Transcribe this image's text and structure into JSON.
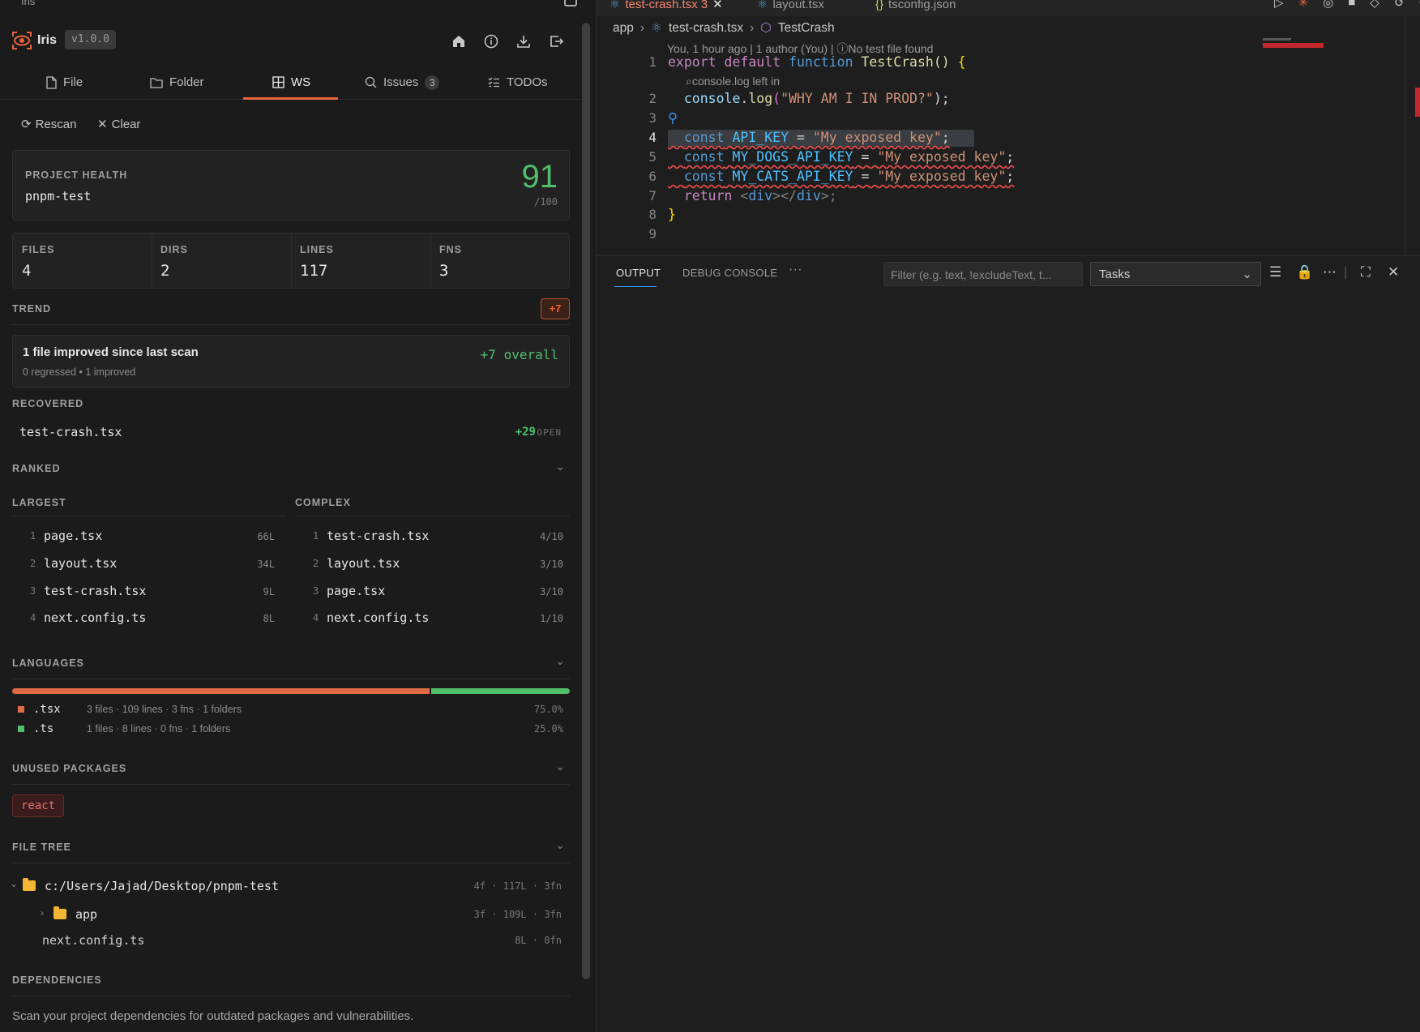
{
  "window": {
    "title": "Iris"
  },
  "app": {
    "name": "Iris",
    "version": "v1.0.0"
  },
  "tabs": [
    {
      "label": "File",
      "icon": "file-icon"
    },
    {
      "label": "Folder",
      "icon": "folder-icon"
    },
    {
      "label": "WS",
      "icon": "grid-icon",
      "active": true
    },
    {
      "label": "Issues",
      "icon": "search-icon",
      "badge": "3"
    },
    {
      "label": "TODOs",
      "icon": "checklist-icon"
    }
  ],
  "actions": {
    "rescan": "Rescan",
    "clear": "Clear"
  },
  "health": {
    "label": "PROJECT HEALTH",
    "project": "pnpm-test",
    "score": "91",
    "max": "/100",
    "score_color": "#4fbf6a"
  },
  "stats": [
    {
      "label": "FILES",
      "value": "4"
    },
    {
      "label": "DIRS",
      "value": "2"
    },
    {
      "label": "LINES",
      "value": "117"
    },
    {
      "label": "FNS",
      "value": "3"
    }
  ],
  "trend": {
    "label": "TREND",
    "badge": "+7",
    "headline": "1 file improved since last scan",
    "detail": "0 regressed • 1 improved",
    "overall": "+7 overall"
  },
  "recovered": {
    "label": "RECOVERED",
    "file": "test-crash.tsx",
    "delta": "+29",
    "action": "OPEN"
  },
  "ranked": {
    "label": "RANKED",
    "largest_label": "LARGEST",
    "complex_label": "COMPLEX",
    "largest": [
      {
        "n": "1",
        "file": "page.tsx",
        "metric": "66L"
      },
      {
        "n": "2",
        "file": "layout.tsx",
        "metric": "34L"
      },
      {
        "n": "3",
        "file": "test-crash.tsx",
        "metric": "9L"
      },
      {
        "n": "4",
        "file": "next.config.ts",
        "metric": "8L"
      }
    ],
    "complex": [
      {
        "n": "1",
        "file": "test-crash.tsx",
        "metric": "4/10"
      },
      {
        "n": "2",
        "file": "layout.tsx",
        "metric": "3/10"
      },
      {
        "n": "3",
        "file": "page.tsx",
        "metric": "3/10"
      },
      {
        "n": "4",
        "file": "next.config.ts",
        "metric": "1/10"
      }
    ]
  },
  "languages": {
    "label": "LANGUAGES",
    "items": [
      {
        "ext": ".tsx",
        "info": "3 files · 109 lines · 3 fns · 1 folders",
        "pct": "75.0%",
        "share": 0.75,
        "color": "#e06c45"
      },
      {
        "ext": ".ts",
        "info": "1 files · 8 lines · 0 fns · 1 folders",
        "pct": "25.0%",
        "share": 0.25,
        "color": "#4fbf6a"
      }
    ]
  },
  "unused_packages": {
    "label": "UNUSED PACKAGES",
    "items": [
      "react"
    ]
  },
  "file_tree": {
    "label": "FILE TREE",
    "root": {
      "path": "c:/Users/Jajad/Desktop/pnpm-test",
      "meta": "4f · 117L · 3fn"
    },
    "children": [
      {
        "name": "app",
        "meta": "3f · 109L · 3fn",
        "type": "folder"
      },
      {
        "name": "next.config.ts",
        "meta": "8L · 0fn",
        "type": "file"
      }
    ]
  },
  "dependencies": {
    "label": "DEPENDENCIES",
    "description": "Scan your project dependencies for outdated packages and vulnerabilities."
  },
  "editor": {
    "tabs": [
      {
        "label": "test-crash.tsx 3",
        "active": true
      },
      {
        "label": "layout.tsx"
      },
      {
        "label": "tsconfig.json"
      }
    ],
    "breadcrumb": [
      "app",
      "test-crash.tsx",
      "TestCrash"
    ],
    "blame": "You, 1 hour ago | 1 author (You) | ⓘNo test file found",
    "codelens": "console.log left in",
    "line_numbers": [
      "1",
      "2",
      "3",
      "4",
      "5",
      "6",
      "7",
      "8",
      "9"
    ],
    "lines": {
      "l1": {
        "a": "export",
        "b": "default",
        "c": "function",
        "d": "TestCrash",
        "e": "()",
        "f": "{"
      },
      "l2": {
        "a": "console",
        "b": ".",
        "c": "log",
        "d": "(",
        "e": "\"WHY AM I IN PROD?\"",
        "f": ");"
      },
      "l4": {
        "a": "const",
        "b": "API_KEY",
        "c": "=",
        "d": "\"My exposed key\"",
        "e": ";"
      },
      "l5": {
        "a": "const",
        "b": "MY_DOGS_API_KEY",
        "c": "=",
        "d": "\"My exposed key\"",
        "e": ";"
      },
      "l6": {
        "a": "const",
        "b": "MY_CATS_API_KEY",
        "c": "=",
        "d": "\"My exposed key\"",
        "e": ";"
      },
      "l7": {
        "a": "return",
        "b": "<",
        "c": "div",
        "d": "></",
        "e": "div",
        "f": ">;"
      },
      "l8": {
        "a": "}"
      }
    }
  },
  "panel": {
    "tabs": [
      "OUTPUT",
      "DEBUG CONSOLE",
      "···"
    ],
    "filter_placeholder": "Filter (e.g. text, !excludeText, t...",
    "select_value": "Tasks"
  }
}
